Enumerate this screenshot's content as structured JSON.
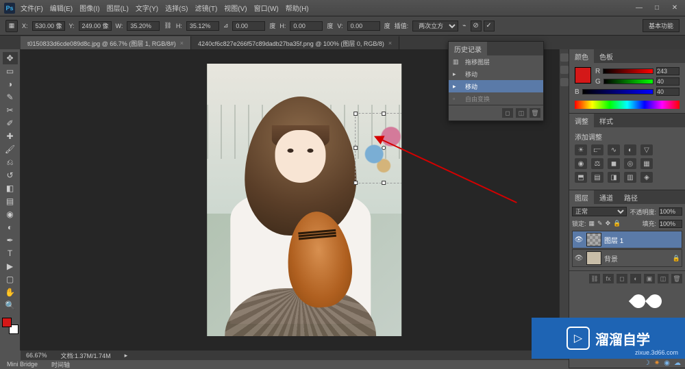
{
  "titlebar": {
    "logo": "Ps"
  },
  "menubar": {
    "items": [
      "文件(F)",
      "编辑(E)",
      "图像(I)",
      "图层(L)",
      "文字(Y)",
      "选择(S)",
      "滤镜(T)",
      "视图(V)",
      "窗口(W)",
      "帮助(H)"
    ]
  },
  "optionsbar": {
    "x_label": "X:",
    "x_val": "530.00 像",
    "y_label": "Y:",
    "y_val": "249.00 像",
    "w_label": "W:",
    "w_val": "35.20%",
    "h_label": "H:",
    "h_val": "35.12%",
    "angle_val": "0.00",
    "angle_unit": "度",
    "hskew_label": "H:",
    "hskew_val": "0.00",
    "hskew_unit": "度",
    "vskew_label": "V:",
    "vskew_val": "0.00",
    "vskew_unit": "度",
    "interp_label": "插值:",
    "interp_val": "两次立方",
    "essentials": "基本功能"
  },
  "tabs": {
    "t1": "t0150833d6cde089d8c.jpg @ 66.7% (图层 1, RGB/8#)",
    "t2": "4240cf6c827e266f57c89dadb27ba35f.png @ 100% (图层 0, RGB/8)"
  },
  "statusbar": {
    "zoom": "66.67%",
    "doc": "文档:1.37M/1.74M"
  },
  "bottombar": {
    "mini": "Mini Bridge",
    "timeline": "时间轴"
  },
  "color_panel": {
    "tab_color": "颜色",
    "tab_swatch": "色板",
    "r": "R",
    "g": "G",
    "b": "B",
    "r_val": "243",
    "g_val": "40",
    "b_val": "40"
  },
  "adjust_panel": {
    "tab_adjust": "调整",
    "tab_style": "样式",
    "add_adjust": "添加调整"
  },
  "layers_panel": {
    "tab_layers": "图层",
    "tab_channels": "通道",
    "tab_paths": "路径",
    "blend": "正常",
    "opacity_label": "不透明度:",
    "opacity_val": "100%",
    "lock_label": "锁定:",
    "fill_label": "填充:",
    "fill_val": "100%",
    "layer1": "图层 1",
    "layer_bg": "背景"
  },
  "history_panel": {
    "tab": "历史记录",
    "h1": "拖移图层",
    "h2": "移动",
    "h3": "移动",
    "h4": "自由变换"
  },
  "watermark": {
    "brand": "溜溜自学",
    "url": "zixue.3d66.com"
  }
}
